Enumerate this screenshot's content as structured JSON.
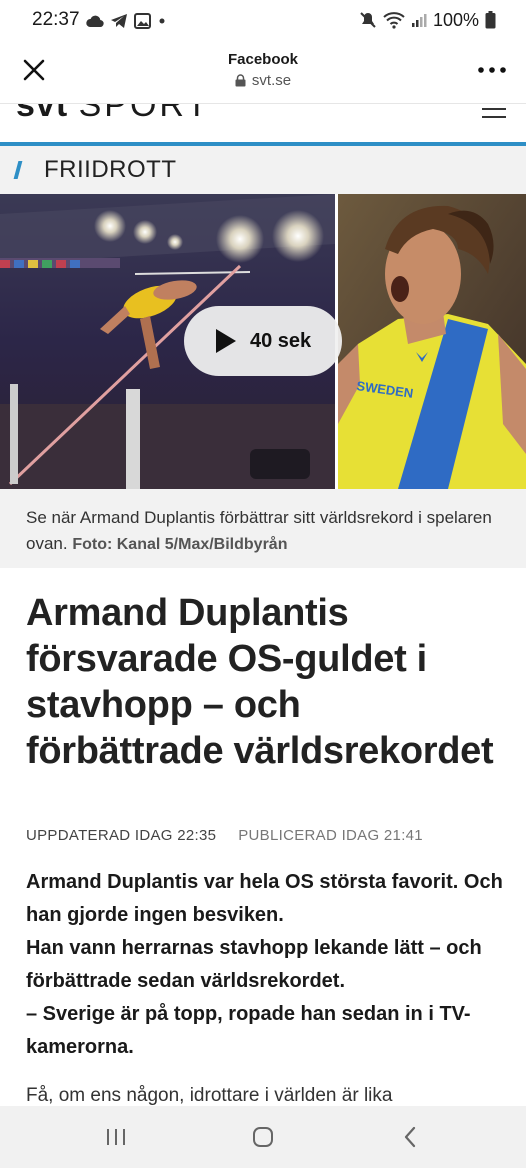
{
  "status_bar": {
    "time": "22:37",
    "battery_percent": "100%",
    "icons_left": [
      "cloud-icon",
      "telegram-icon",
      "gallery-icon",
      "dot-icon"
    ],
    "icons_right": [
      "mute-icon",
      "wifi-icon",
      "signal-icon",
      "battery-icon"
    ]
  },
  "browser": {
    "title": "Facebook",
    "url": "svt.se"
  },
  "site": {
    "logo_bold": "svt",
    "logo_light": "SPORT",
    "section": "FRIIDROTT",
    "accent_color": "#2e8fc6"
  },
  "media": {
    "video_duration": "40 sek",
    "jersey_text": "SWEDEN"
  },
  "caption": {
    "text": "Se när Armand Duplantis förbättrar sitt världsrekord i spelaren ovan.",
    "credit": "Foto: Kanal 5/Max/Bildbyrån"
  },
  "article": {
    "headline": "Armand Duplantis försvarade OS-guldet i stavhopp – och förbättrade världsrekordet",
    "updated": "UPPDATERAD IDAG 22:35",
    "published": "PUBLICERAD IDAG 21:41",
    "lead_1": "Armand Duplantis var hela OS största favorit. Och han gjorde ingen besviken.",
    "lead_2": "Han vann herrarnas stavhopp lekande lätt – och förbättrade sedan världsrekordet.",
    "lead_3": "– Sverige är på topp, ropade han sedan in i TV-kamerorna.",
    "body_start": "Få, om ens någon, idrottare i världen är lika"
  }
}
